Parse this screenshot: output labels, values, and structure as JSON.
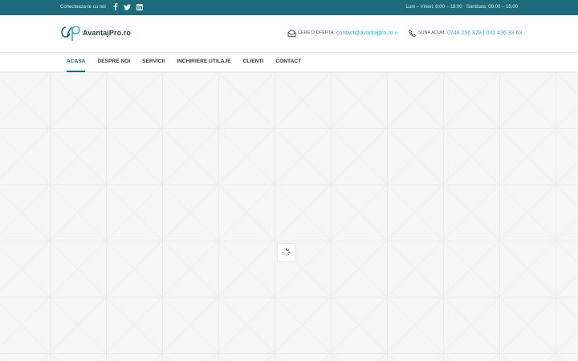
{
  "topbar": {
    "connect_text": "Conecteaza-te cu noi",
    "socials": [
      "facebook-icon",
      "twitter-icon",
      "linkedin-icon"
    ],
    "hours": "Luni – Vineri: 8:00 – 18:00 · Sambata: 09:00 – 15:00"
  },
  "header": {
    "logo_text": "AvantajPro.ro",
    "email_label": "Cere o oferta:",
    "email_value": "contact@avantajpro.ro »",
    "phone_label": "Suna acum:",
    "phone_value": "0748 256 878 | 031 436 33 63"
  },
  "nav": {
    "items": [
      {
        "label": "ACASA",
        "active": true
      },
      {
        "label": "DESPRE NOI"
      },
      {
        "label": "SERVICII"
      },
      {
        "label": "INCHIRIERE UTILAJE"
      },
      {
        "label": "CLIENTI"
      },
      {
        "label": "CONTACT"
      }
    ]
  },
  "colors": {
    "brand": "#1d6b7a",
    "accent": "#3aaec0",
    "text_dark": "#2f3a40"
  },
  "icons": {
    "loader": "loading-spinner-icon",
    "email": "envelope-icon",
    "phone": "phone-icon"
  }
}
